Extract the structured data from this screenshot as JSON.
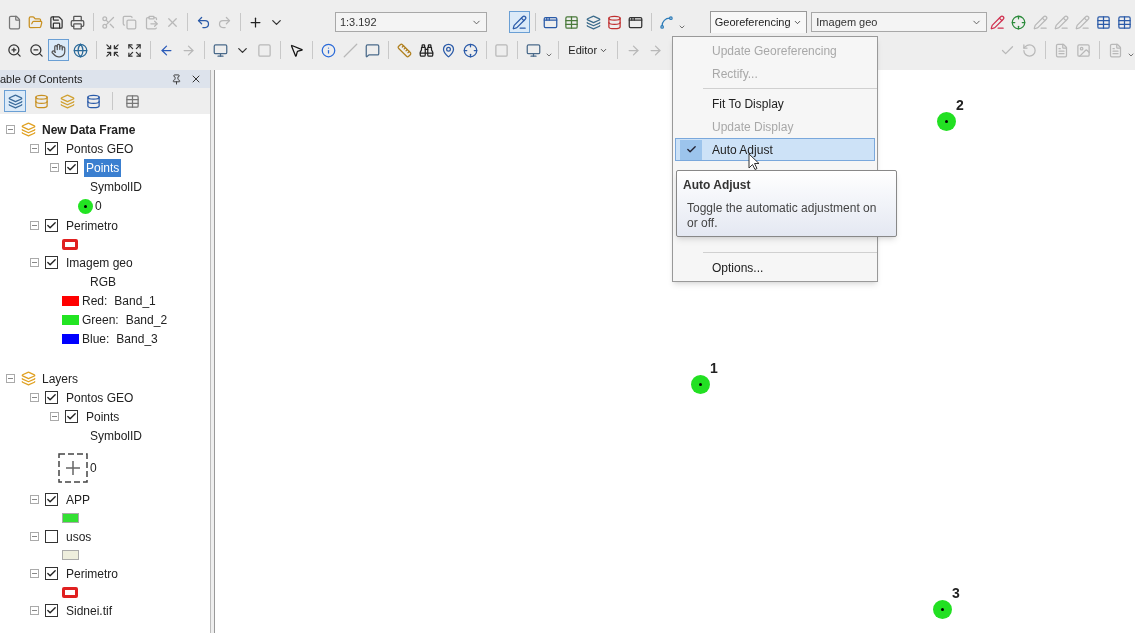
{
  "toolbar": {
    "scale": "1:3.192",
    "editor_menu": "Editor",
    "georeferencing_menu": "Georeferencing",
    "layer_combo": "Imagem geo"
  },
  "georeferencing_dropdown": {
    "items": [
      {
        "kind": "item",
        "label": "Update Georeferencing",
        "disabled": true,
        "checked": false,
        "selected": false
      },
      {
        "kind": "item",
        "label": "Rectify...",
        "disabled": true,
        "checked": false,
        "selected": false
      },
      {
        "kind": "separator"
      },
      {
        "kind": "item",
        "label": "Fit To Display",
        "disabled": false,
        "checked": false,
        "selected": false
      },
      {
        "kind": "item",
        "label": "Update Display",
        "disabled": true,
        "checked": false,
        "selected": false
      },
      {
        "kind": "item",
        "label": "Auto Adjust",
        "disabled": false,
        "checked": true,
        "selected": true
      },
      {
        "kind": "covered"
      },
      {
        "kind": "separator"
      },
      {
        "kind": "item",
        "label": "Options...",
        "disabled": false,
        "checked": false,
        "selected": false
      }
    ]
  },
  "tooltip": {
    "title": "Auto Adjust",
    "text": "Toggle the automatic adjustment on or off."
  },
  "table_of_contents": {
    "title": "able Of Contents",
    "frames": [
      {
        "name": "New Data Frame",
        "active": true,
        "expanded": true,
        "layers": [
          {
            "name": "Pontos GEO",
            "checked": true,
            "expanded": true,
            "selected": false,
            "children": [
              {
                "name": "Points",
                "checked": true,
                "expanded": true,
                "selected": true,
                "legend": [
                  {
                    "kind": "heading",
                    "text": "SymbolID"
                  },
                  {
                    "kind": "dot",
                    "label": "0",
                    "color": "#22e422"
                  }
                ]
              }
            ]
          },
          {
            "name": "Perimetro",
            "checked": true,
            "expanded": true,
            "selected": false,
            "legend": [
              {
                "kind": "outline",
                "color": "#e02020"
              }
            ]
          },
          {
            "name": "Imagem geo",
            "checked": true,
            "expanded": true,
            "selected": false,
            "legend": [
              {
                "kind": "heading",
                "text": "RGB"
              },
              {
                "kind": "band",
                "label": "Red:",
                "value": "Band_1",
                "color": "#ff0000"
              },
              {
                "kind": "band",
                "label": "Green:",
                "value": "Band_2",
                "color": "#22e422"
              },
              {
                "kind": "band",
                "label": "Blue:",
                "value": "Band_3",
                "color": "#0000ff"
              }
            ]
          }
        ]
      },
      {
        "name": "Layers",
        "active": false,
        "expanded": true,
        "layers": [
          {
            "name": "Pontos GEO",
            "checked": true,
            "expanded": true,
            "selected": false,
            "children": [
              {
                "name": "Points",
                "checked": true,
                "expanded": true,
                "selected": false,
                "legend": [
                  {
                    "kind": "heading",
                    "text": "SymbolID"
                  },
                  {
                    "kind": "marker",
                    "label": "0"
                  }
                ]
              }
            ]
          },
          {
            "name": "APP",
            "checked": true,
            "expanded": true,
            "selected": false,
            "legend": [
              {
                "kind": "fill",
                "color": "#33e033"
              }
            ]
          },
          {
            "name": "usos",
            "checked": false,
            "expanded": true,
            "selected": false,
            "legend": [
              {
                "kind": "fill",
                "color": "#eeeedd"
              }
            ]
          },
          {
            "name": "Perimetro",
            "checked": true,
            "expanded": true,
            "selected": false,
            "legend": [
              {
                "kind": "outline",
                "color": "#e02020"
              }
            ]
          },
          {
            "name": "Sidnei.tif",
            "checked": true,
            "expanded": true,
            "selected": false
          }
        ]
      }
    ]
  },
  "map": {
    "points": [
      {
        "label": "2"
      },
      {
        "label": "1"
      },
      {
        "label": "3"
      }
    ]
  }
}
